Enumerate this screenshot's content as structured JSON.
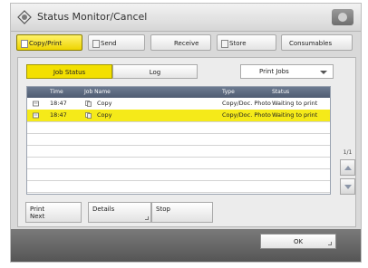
{
  "window": {
    "title": "Status Monitor/Cancel"
  },
  "tabs": [
    {
      "label": "Copy/Print",
      "active": true
    },
    {
      "label": "Send",
      "active": false
    },
    {
      "label": "Receive",
      "active": false
    },
    {
      "label": "Store",
      "active": false
    },
    {
      "label": "Consumables",
      "active": false
    }
  ],
  "subtabs": {
    "job_status": "Job Status",
    "log": "Log"
  },
  "filter": {
    "selected": "Print Jobs"
  },
  "table": {
    "headers": {
      "time": "Time",
      "job_name": "Job Name",
      "type": "Type",
      "status": "Status"
    },
    "rows": [
      {
        "time": "18:47",
        "job_name": "Copy",
        "type": "Copy/Doc. Photo",
        "status": "Waiting to print",
        "selected": false
      },
      {
        "time": "18:47",
        "job_name": "Copy",
        "type": "Copy/Doc. Photo",
        "status": "Waiting to print",
        "selected": true
      }
    ]
  },
  "pager": {
    "text": "1/1"
  },
  "bottom_buttons": {
    "print_next": "Print\nNext",
    "details": "Details",
    "stop": "Stop"
  },
  "footer": {
    "ok": "OK"
  },
  "colors": {
    "accent_yellow": "#f3e000",
    "header_blue": "#55627a",
    "footer_gray": "#606060"
  }
}
